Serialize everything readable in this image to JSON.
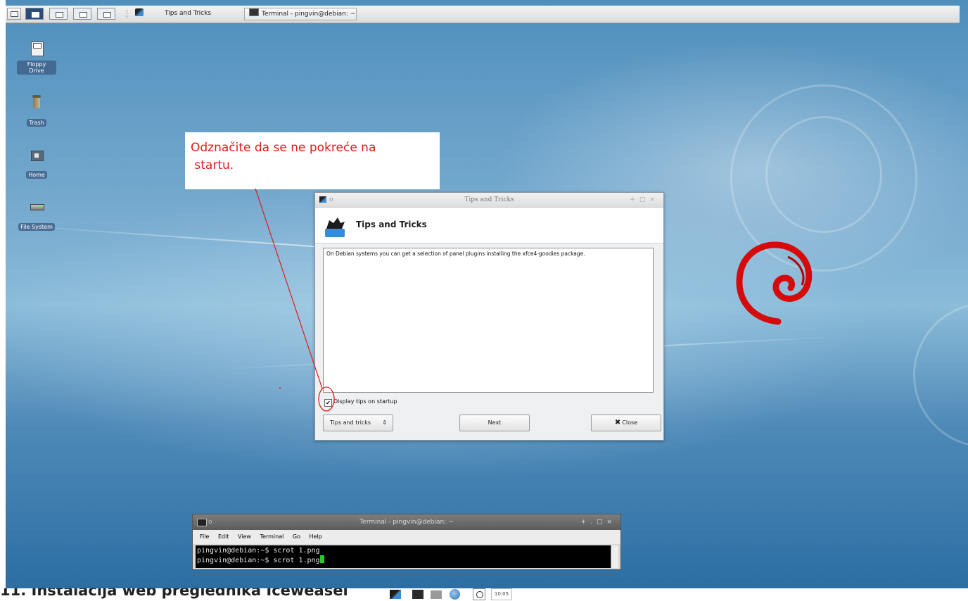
{
  "top_panel": {
    "workspaces": [
      "1",
      "2",
      "3",
      "4"
    ],
    "tasks": [
      {
        "label": "Tips and Tricks",
        "icon": "xfce-mouse-icon"
      },
      {
        "label": "Terminal - pingvin@debian: ~",
        "icon": "terminal-icon"
      }
    ]
  },
  "desktop_icons": [
    {
      "label": "Floppy Drive",
      "icon": "floppy-icon"
    },
    {
      "label": "Trash",
      "icon": "trash-icon"
    },
    {
      "label": "Home",
      "icon": "home-folder-icon"
    },
    {
      "label": "File System",
      "icon": "drive-icon"
    }
  ],
  "callout": {
    "text": "Odznačite da se ne pokreće na\n startu.",
    "color": "#e21b1b"
  },
  "tips_dialog": {
    "window_title": "Tips and Tricks",
    "header_title": "Tips and Tricks",
    "tip_text": "On Debian systems you can get a selection of panel plugins installing the xfce4-goodies package.",
    "checkbox_label": "Display tips on startup",
    "checkbox_checked": true,
    "category_select": "Tips and tricks",
    "next_button": "Next",
    "close_button": "Close"
  },
  "terminal": {
    "window_title": "Terminal - pingvin@debian: ~",
    "menu": [
      "File",
      "Edit",
      "View",
      "Terminal",
      "Go",
      "Help"
    ],
    "lines": [
      "pingvin@debian:~$ scrot 1.png",
      "pingvin@debian:~$ scrot 1.png"
    ]
  },
  "caption": {
    "text": "11. Instalacija web preglednika Iceweasel"
  },
  "bottom_panel": {
    "clock": "10:05"
  },
  "colors": {
    "accent_workspace": "#2a4c78",
    "debian_red": "#d50a0a",
    "terminal_cursor": "#1fd01f"
  }
}
